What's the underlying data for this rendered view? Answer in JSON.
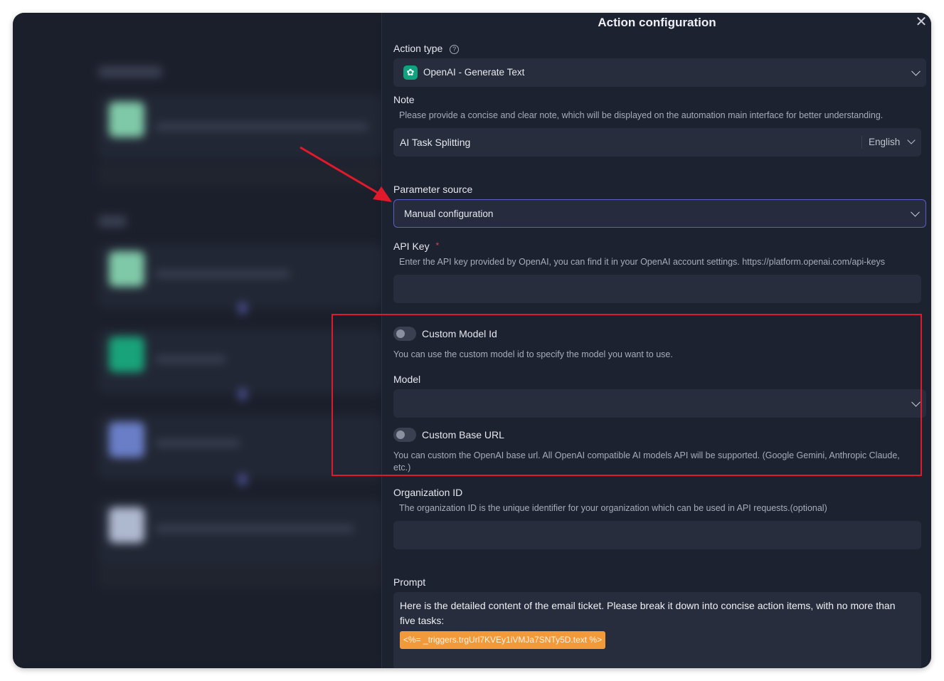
{
  "panel": {
    "title": "Action configuration"
  },
  "action_type": {
    "label": "Action type",
    "value": "OpenAI - Generate Text"
  },
  "note": {
    "label": "Note",
    "description": "Please provide a concise and clear note, which will be displayed on the automation main interface for better understanding.",
    "value": "AI Task Splitting",
    "language": "English"
  },
  "parameter_source": {
    "label": "Parameter source",
    "value": "Manual configuration"
  },
  "api_key": {
    "label": "API Key",
    "required_mark": "*",
    "description": "Enter the API key provided by OpenAI, you can find it in your OpenAI account settings. https://platform.openai.com/api-keys",
    "value": ""
  },
  "custom_model_id": {
    "label": "Custom Model Id",
    "description": "You can use the custom model id to specify the model you want to use."
  },
  "model": {
    "label": "Model",
    "value": ""
  },
  "custom_base_url": {
    "label": "Custom Base URL",
    "description_line1": "You can custom the OpenAI base url. All OpenAI compatible AI models API will be supported. (Google Gemini, Anthropic Claude,",
    "description_line2": "etc.)"
  },
  "organization_id": {
    "label": "Organization ID",
    "description": "The organization ID is the unique identifier for your organization which can be used in API requests.(optional)",
    "value": ""
  },
  "prompt": {
    "label": "Prompt",
    "text_line1": "Here is the detailed content of the email ticket. Please break it down into concise action items, with no more than",
    "text_line2": "five tasks:",
    "variable": "<%= _triggers.trgUrl7KVEy1iVMJa7SNTy5D.text %>"
  },
  "colors": {
    "accent_border": "#5a5fc8",
    "highlight_box": "#e0192b",
    "variable_tag": "#f29a3a",
    "openai_icon": "#10a37f"
  }
}
